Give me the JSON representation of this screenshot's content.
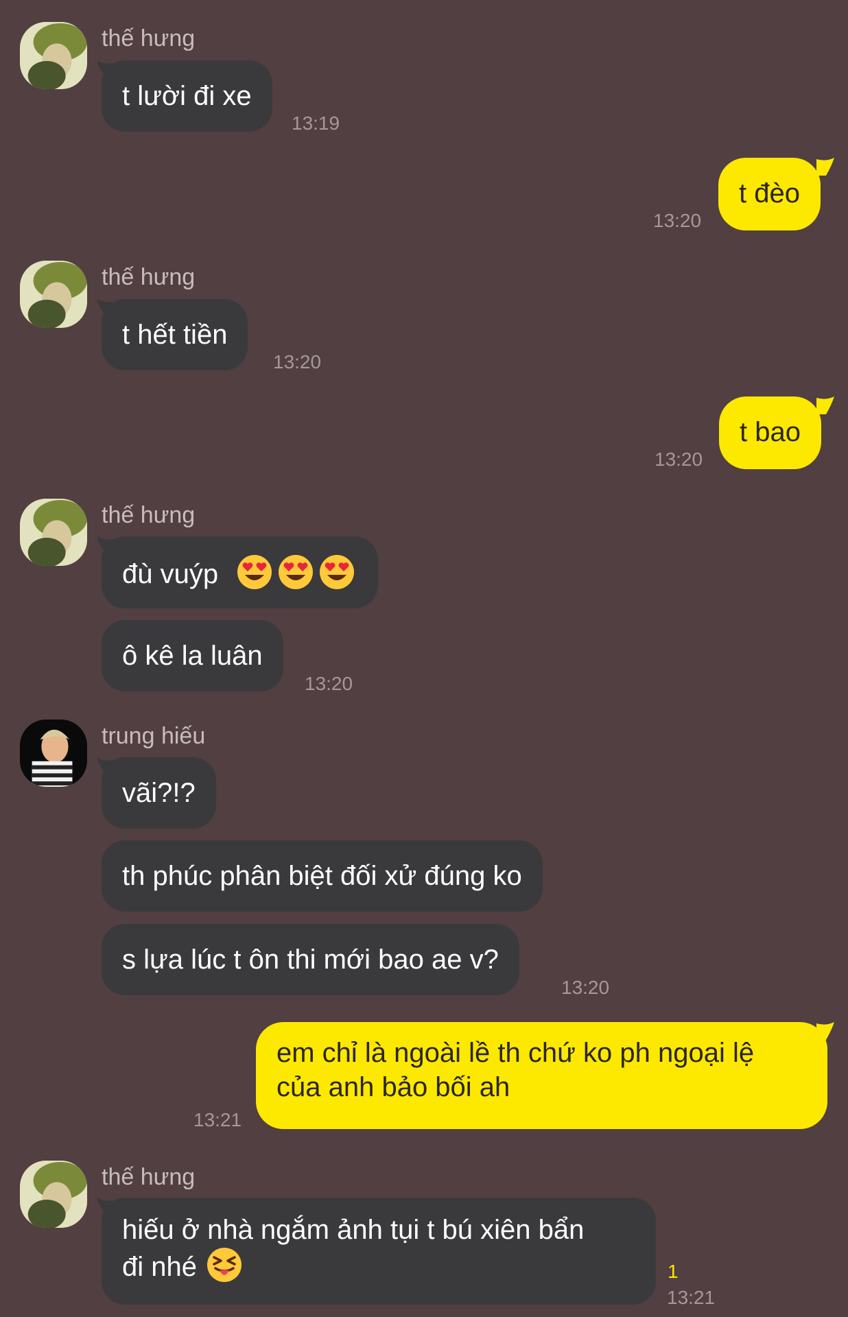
{
  "colors": {
    "background": "#523f41",
    "incoming_bubble": "#3a3a3c",
    "outgoing_bubble": "#fde800",
    "unread_count": "#fde800"
  },
  "messages": [
    {
      "sender": "thế hưng",
      "text": "t lười đi xe",
      "time": "13:19"
    },
    {
      "text": "t đèo",
      "time": "13:20"
    },
    {
      "sender": "thế hưng",
      "text": "t hết tiền",
      "time": "13:20"
    },
    {
      "text": "t bao",
      "time": "13:20"
    },
    {
      "sender": "thế hưng",
      "text": "đù vuýp",
      "emoji": [
        "heart-eyes-emoji",
        "heart-eyes-emoji",
        "heart-eyes-emoji"
      ]
    },
    {
      "text": "ô kê la luân",
      "time": "13:20"
    },
    {
      "sender": "trung hiếu",
      "text": "vãi?!?"
    },
    {
      "text": "th phúc phân biệt đối xử đúng ko"
    },
    {
      "text": "s lựa lúc t ôn thi mới bao ae v?",
      "time": "13:20"
    },
    {
      "text_line1": "em chỉ là ngoài lề th chứ ko ph ngoại lệ",
      "text_line2": "của anh bảo bối ah",
      "time": "13:21"
    },
    {
      "sender": "thế hưng",
      "text_line1": "hiếu ở nhà ngắm ảnh tụi t bú xiên bẩn",
      "text_line2": "đi nhé",
      "emoji": [
        "squinting-tongue-emoji"
      ],
      "unread": "1",
      "time": "13:21"
    }
  ]
}
